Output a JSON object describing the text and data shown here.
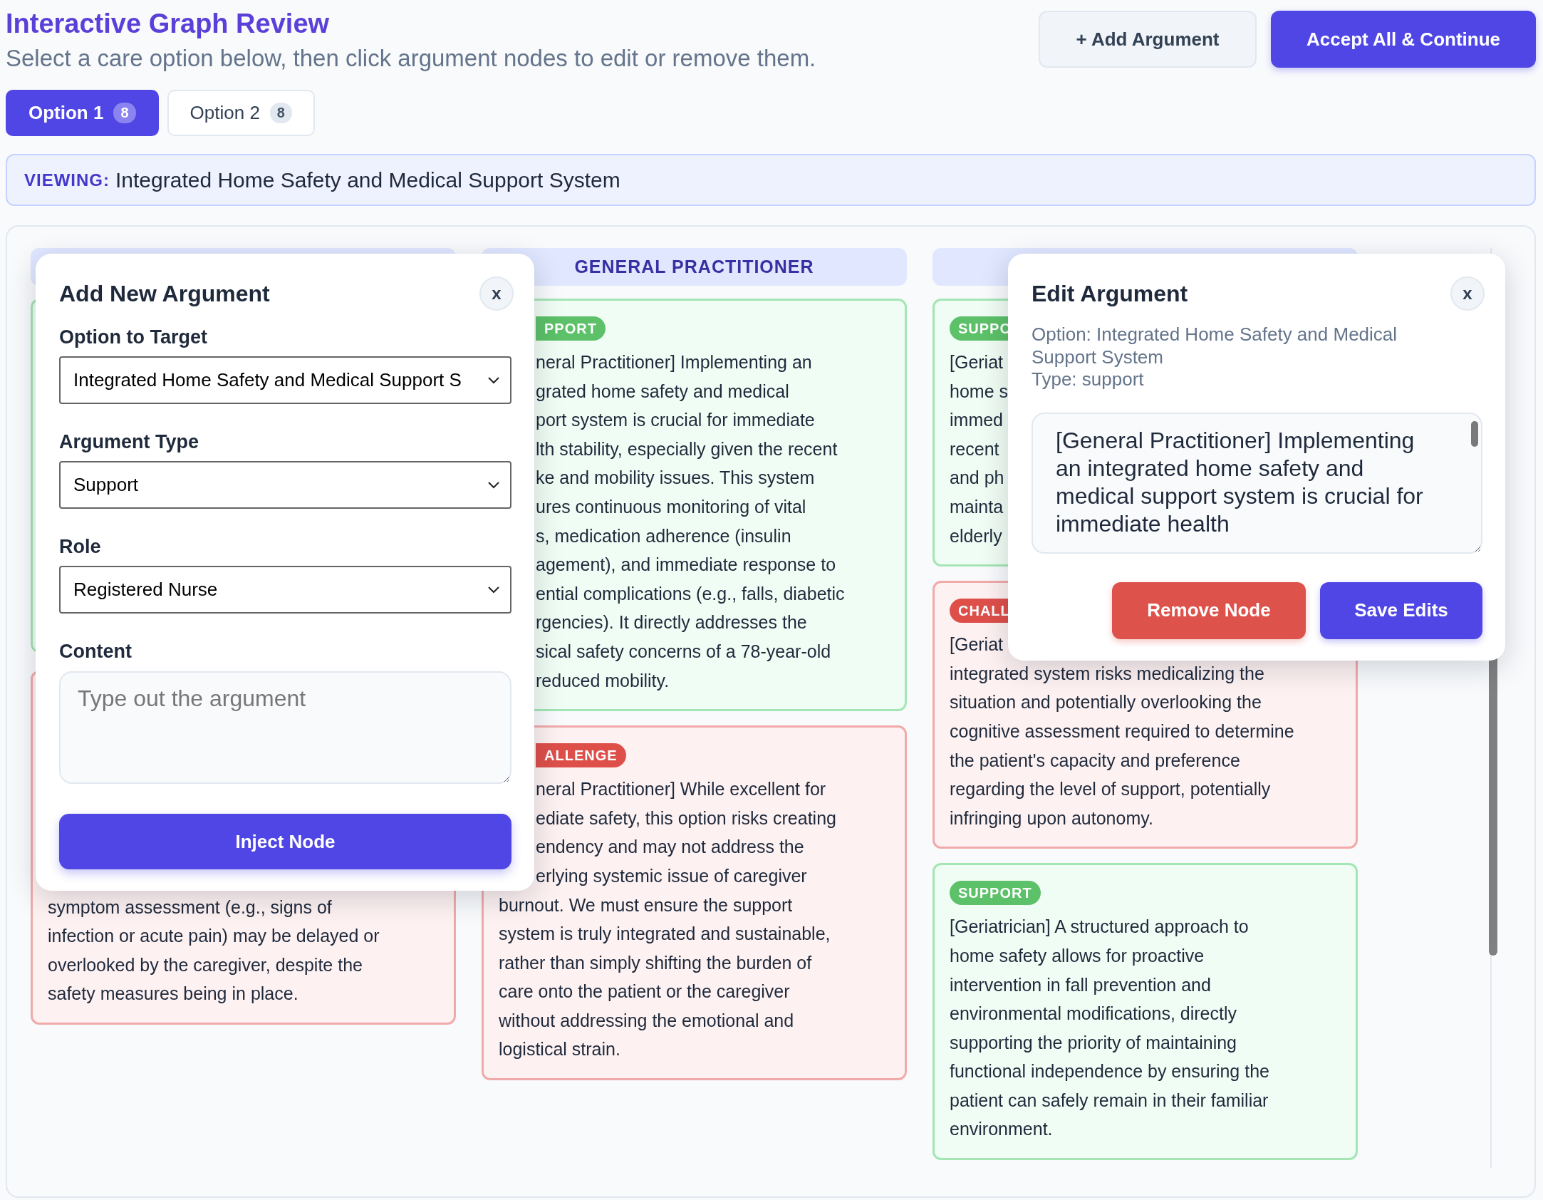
{
  "header": {
    "title": "Interactive Graph Review",
    "subtitle": "Select a care option below, then click argument nodes to edit or remove them."
  },
  "actions": [
    {
      "label": "+ Add Argument",
      "kind": "secondary"
    },
    {
      "label": "Accept All & Continue",
      "kind": "primary"
    }
  ],
  "tabs": [
    {
      "label": "Option 1",
      "count": "8",
      "selected": true
    },
    {
      "label": "Option 2",
      "count": "8",
      "selected": false
    }
  ],
  "viewing": {
    "label": "VIEWING:",
    "value": "Integrated Home Safety and Medical Support System"
  },
  "columns": [
    {
      "cards": [
        {
          "kind": "support"
        },
        {
          "kind": "challenge",
          "lines": [
            {
              "text": "symptom assessment (e.g., signs of",
              "hidden_start": false
            },
            {
              "text": "infection or acute pain) may be delayed or",
              "hidden_start": false
            },
            {
              "text": "overlooked by the caregiver, despite the",
              "hidden_start": false
            },
            {
              "text": "safety measures being in place.",
              "hidden_start": false
            }
          ]
        }
      ]
    },
    {
      "header": "GENERAL PRACTITIONER",
      "cards": [
        {
          "kind": "support",
          "badge": {
            "text": "PPORT",
            "hidden_start": true
          },
          "lines": [
            {
              "text": "neral Practitioner] Implementing an",
              "hidden_start": true
            },
            {
              "text": "grated home safety and medical",
              "hidden_start": true
            },
            {
              "text": "port system is crucial for immediate",
              "hidden_start": true
            },
            {
              "text": "lth stability, especially given the recent",
              "hidden_start": true
            },
            {
              "text": "ke and mobility issues. This system",
              "hidden_start": true
            },
            {
              "text": "ures continuous monitoring of vital",
              "hidden_start": true
            },
            {
              "text": "s, medication adherence (insulin",
              "hidden_start": true
            },
            {
              "text": "agement), and immediate response to",
              "hidden_start": true
            },
            {
              "text": "ential complications (e.g., falls, diabetic",
              "hidden_start": true
            },
            {
              "text": "rgencies). It directly addresses the",
              "hidden_start": true
            },
            {
              "text": "sical safety concerns of a 78-year-old",
              "hidden_start": true
            },
            {
              "text": "reduced mobility.",
              "hidden_start": true
            }
          ]
        },
        {
          "kind": "challenge",
          "badge": {
            "text": "ALLENGE",
            "hidden_start": true
          },
          "lines": [
            {
              "text": "neral Practitioner] While excellent for",
              "hidden_start": true
            },
            {
              "text": "ediate safety, this option risks creating",
              "hidden_start": true
            },
            {
              "text": "endency and may not address the",
              "hidden_start": true
            },
            {
              "text": "erlying systemic issue of caregiver",
              "hidden_start": true
            },
            {
              "text": "burnout. We must ensure the support",
              "hidden_start": false
            },
            {
              "text": "system is truly integrated and sustainable,",
              "hidden_start": false
            },
            {
              "text": "rather than simply shifting the burden of",
              "hidden_start": false
            },
            {
              "text": "care onto the patient or the caregiver",
              "hidden_start": false
            },
            {
              "text": "without addressing the emotional and",
              "hidden_start": false
            },
            {
              "text": "logistical strain.",
              "hidden_start": false
            }
          ]
        }
      ]
    },
    {
      "cards": [
        {
          "kind": "support",
          "badge": {
            "text": "SUPPO",
            "hidden_start": false
          },
          "lines": [
            {
              "text": "[Geriat",
              "hidden_start": false
            },
            {
              "text": "home s",
              "hidden_start": false
            },
            {
              "text": "immed",
              "hidden_start": false
            },
            {
              "text": "recent",
              "hidden_start": false
            },
            {
              "text": "and ph",
              "hidden_start": false
            },
            {
              "text": "mainta",
              "hidden_start": false
            },
            {
              "text": "elderly",
              "hidden_start": false
            }
          ]
        },
        {
          "kind": "challenge",
          "badge": {
            "text": "CHALL",
            "hidden_start": false
          },
          "lines": [
            {
              "text": "[Geriat",
              "hidden_start": false
            },
            {
              "text": "integrated system risks medicalizing the",
              "hidden_start": false
            },
            {
              "text": "situation and potentially overlooking the",
              "hidden_start": false
            },
            {
              "text": "cognitive assessment required to determine",
              "hidden_start": false
            },
            {
              "text": "the patient's capacity and preference",
              "hidden_start": false
            },
            {
              "text": "regarding the level of support, potentially",
              "hidden_start": false
            },
            {
              "text": "infringing upon autonomy.",
              "hidden_start": false
            }
          ]
        },
        {
          "kind": "support",
          "badge": {
            "text": "SUPPORT",
            "hidden_start": false
          },
          "lines": [
            {
              "text": "[Geriatrician] A structured approach to",
              "hidden_start": false
            },
            {
              "text": "home safety allows for proactive",
              "hidden_start": false
            },
            {
              "text": "intervention in fall prevention and",
              "hidden_start": false
            },
            {
              "text": "environmental modifications, directly",
              "hidden_start": false
            },
            {
              "text": "supporting the priority of maintaining",
              "hidden_start": false
            },
            {
              "text": "functional independence by ensuring the",
              "hidden_start": false
            },
            {
              "text": "patient can safely remain in their familiar",
              "hidden_start": false
            },
            {
              "text": "environment.",
              "hidden_start": false
            }
          ]
        }
      ]
    }
  ],
  "add_dialog": {
    "title": "Add New Argument",
    "close_label": "x",
    "fields": [
      {
        "label": "Option to Target",
        "value": "Integrated Home Safety and Medical Support S"
      },
      {
        "label": "Argument Type",
        "value": "Support"
      },
      {
        "label": "Role",
        "value": "Registered Nurse"
      }
    ],
    "content": {
      "label": "Content",
      "placeholder": "Type out the argument"
    },
    "submit": "Inject Node"
  },
  "edit_dialog": {
    "title": "Edit Argument",
    "close_label": "x",
    "info": [
      "Option: Integrated Home Safety and Medical Support System",
      "Type: support"
    ],
    "content": "[General Practitioner] Implementing an integrated home safety and medical support system is crucial for immediate health",
    "remove": "Remove Node",
    "save": "Save Edits"
  }
}
